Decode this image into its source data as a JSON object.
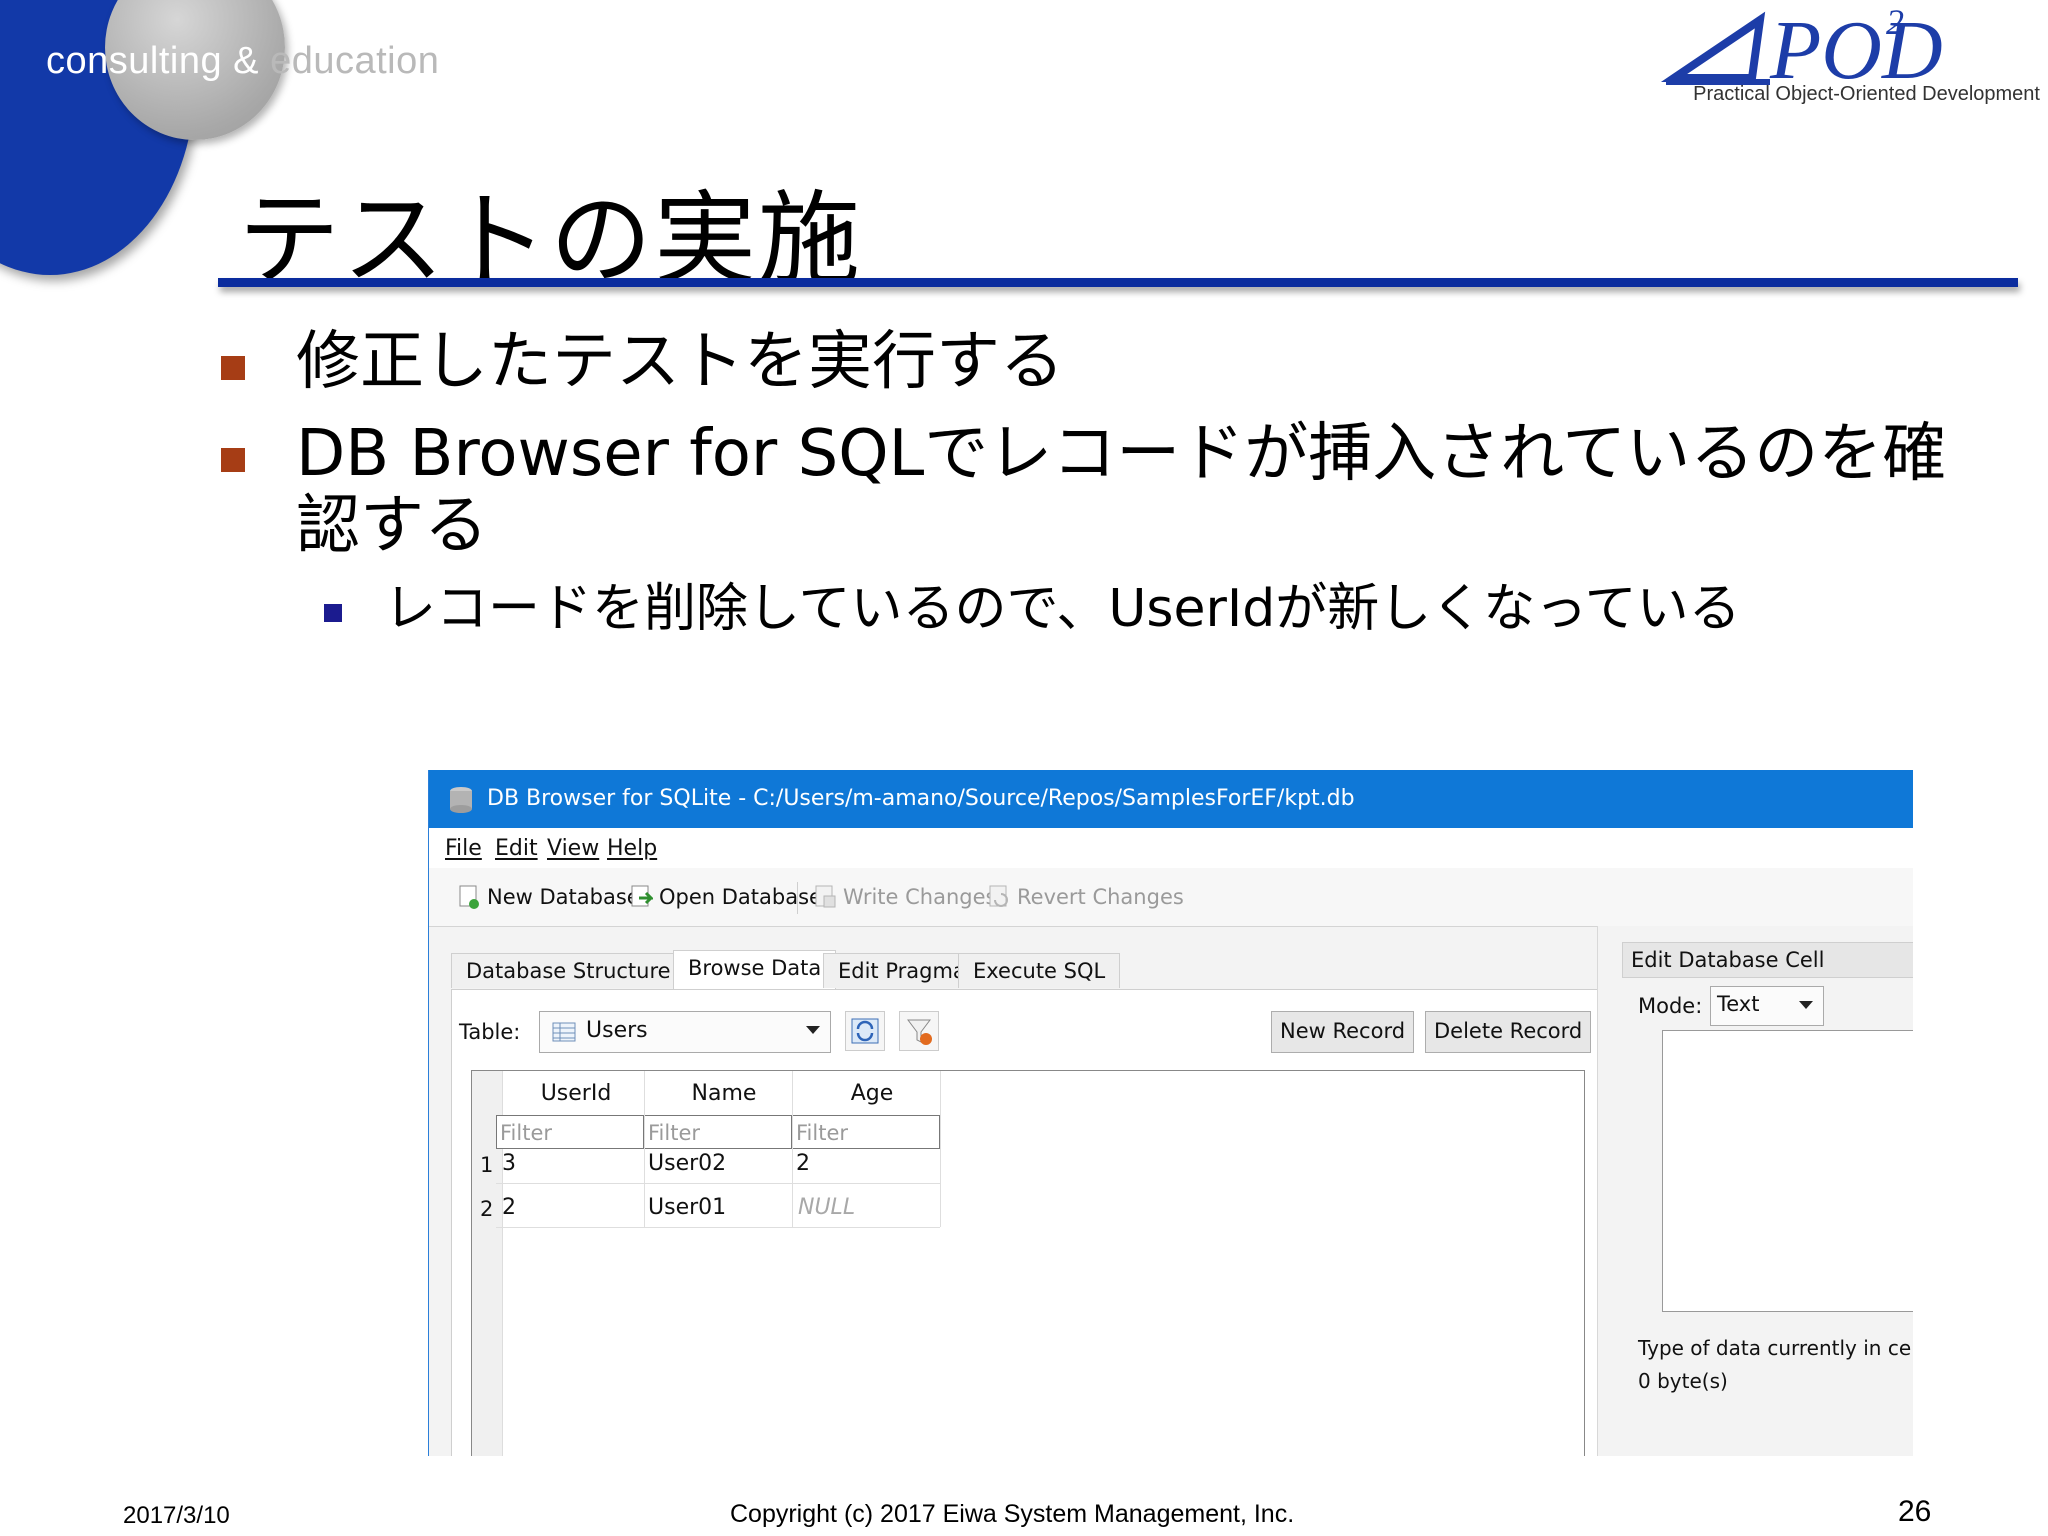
{
  "slide": {
    "tagline_part1": "consulting &",
    "tagline_part2": " education",
    "logo_text": "POD",
    "logo_superscript": "2",
    "logo_subtitle": "Practical Object-Oriented Development",
    "title": "テストの実施",
    "bullets": [
      "修正したテストを実行する",
      "DB Browser for SQLでレコードが挿入されているのを確認する"
    ],
    "sub_bullet": "レコードを削除しているので、UserIdが新しくなっている",
    "footer_date": "2017/3/10",
    "footer_copyright": "Copyright (c) 2017 Eiwa System Management, Inc.",
    "page_number": "26",
    "colors": {
      "circle_blue": "#1239a8",
      "rule_blue": "#0b2c9e",
      "bullet_mark": "#a63d15",
      "sub_bullet_mark": "#1b1b8f"
    }
  },
  "app": {
    "window_title": "DB Browser for SQLite - C:/Users/m-amano/Source/Repos/SamplesForEF/kpt.db",
    "menu": [
      "File",
      "Edit",
      "View",
      "Help"
    ],
    "toolbar": {
      "new_database": "New Database",
      "open_database": "Open Database",
      "write_changes": "Write Changes",
      "revert_changes": "Revert Changes"
    },
    "tabs": [
      "Database Structure",
      "Browse Data",
      "Edit Pragmas",
      "Execute SQL"
    ],
    "active_tab": "Browse Data",
    "table_label": "Table:",
    "table_selected": "Users",
    "new_record": "New Record",
    "delete_record": "Delete Record",
    "grid": {
      "columns": [
        "UserId",
        "Name",
        "Age"
      ],
      "filter_placeholder": "Filter",
      "rows": [
        {
          "num": "1",
          "cells": [
            "3",
            "User02",
            "2"
          ]
        },
        {
          "num": "2",
          "cells": [
            "2",
            "User01",
            "NULL"
          ]
        }
      ]
    },
    "dock": {
      "title": "Edit Database Cell",
      "mode_label": "Mode:",
      "mode_value": "Text",
      "info_type": "Type of data currently in ce",
      "info_size": "0 byte(s)"
    },
    "titlebar_color": "#0f78d7"
  }
}
